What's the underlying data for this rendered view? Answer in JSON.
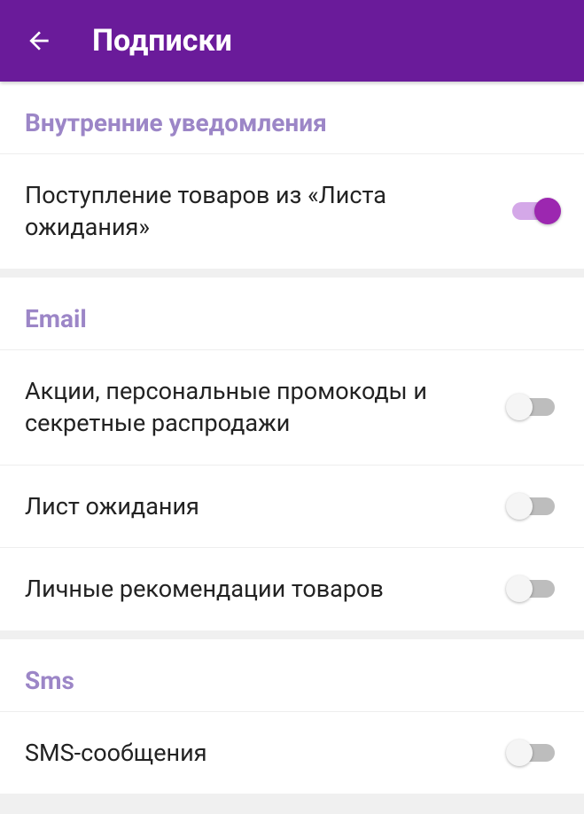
{
  "header": {
    "title": "Подписки"
  },
  "sections": [
    {
      "title": "Внутренние уведомления",
      "items": [
        {
          "label": "Поступление товаров из «Листа ожидания»",
          "on": true
        }
      ]
    },
    {
      "title": "Email",
      "items": [
        {
          "label": "Акции, персональные промокоды и секретные распродажи",
          "on": false
        },
        {
          "label": "Лист ожидания",
          "on": false
        },
        {
          "label": "Личные рекомендации товаров",
          "on": false
        }
      ]
    },
    {
      "title": "Sms",
      "items": [
        {
          "label": "SMS-сообщения",
          "on": false
        }
      ]
    }
  ]
}
